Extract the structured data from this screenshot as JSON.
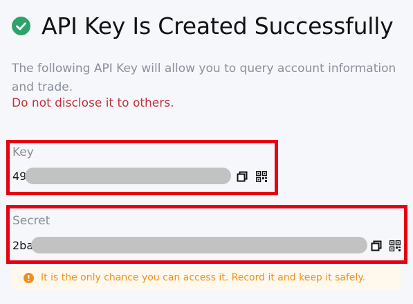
{
  "header": {
    "title": "API Key Is Created Successfully"
  },
  "description": "The following API Key will allow you to query account information and trade.",
  "warning": "Do not disclose it to others.",
  "key": {
    "label": "Key",
    "value_prefix": "49"
  },
  "secret": {
    "label": "Secret",
    "value_prefix": "2ba"
  },
  "notice": {
    "text": "It is the only chance you can access it. Record it and keep it safely."
  },
  "colors": {
    "success": "#2ea26b",
    "danger": "#c4303a",
    "highlight": "#e60012",
    "notice": "#ef8f1e",
    "notice_bg": "#fff8ec"
  },
  "icons": {
    "header": "check-circle-icon",
    "copy": "copy-icon",
    "qr": "qr-code-icon",
    "notice": "info-icon"
  }
}
